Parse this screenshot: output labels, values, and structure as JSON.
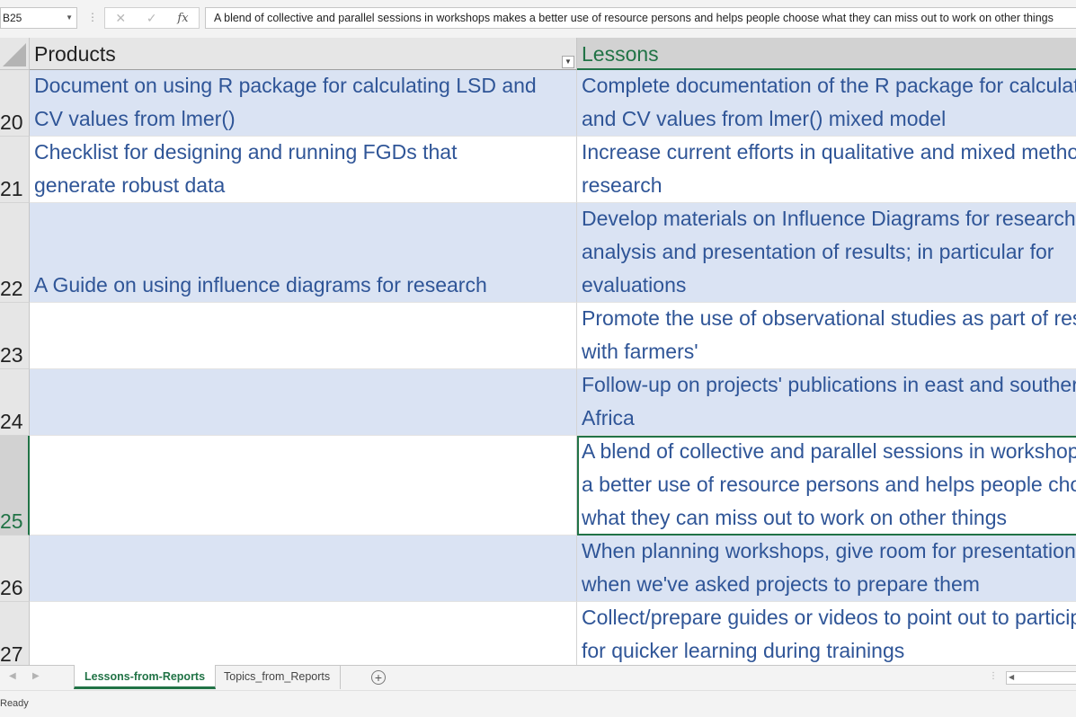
{
  "formula_bar": {
    "name_box": "B25",
    "cancel_icon": "✕",
    "enter_icon": "✓",
    "fx_label": "fx",
    "formula": "A blend of collective and parallel sessions in workshops makes a better use of resource persons and helps people choose what they can miss out to work on other things"
  },
  "columns": {
    "a": "Products",
    "b": "Lessons"
  },
  "rows": [
    {
      "num": "20",
      "a": "Document on using R package for calculating LSD and\nCV values from lmer()",
      "b": "Complete documentation of the R package for calculating LSD\nand CV values from lmer() mixed model"
    },
    {
      "num": "21",
      "a": "Checklist for designing and running FGDs that\ngenerate robust data",
      "b": "Increase current efforts in qualitative and mixed methods\nresearch"
    },
    {
      "num": "22",
      "a": "A Guide on using influence diagrams for research",
      "b": "Develop materials on Influence Diagrams for research design,\nanalysis and presentation of results; in particular for\nevaluations"
    },
    {
      "num": "23",
      "a": "",
      "b": "Promote the use of observational studies as part of research\nwith farmers'"
    },
    {
      "num": "24",
      "a": "",
      "b": "Follow-up on projects' publications in east and southern\nAfrica"
    },
    {
      "num": "25",
      "a": "",
      "b": "A blend of collective and parallel sessions in workshops makes\na better use of resource persons and helps people choose\nwhat they can miss out to work on other things"
    },
    {
      "num": "26",
      "a": "",
      "b": "When planning workshops, give room for presentations\nwhen we've asked projects to prepare them"
    },
    {
      "num": "27",
      "a": "",
      "b": "Collect/prepare guides or videos to point out to participants\nfor quicker learning during trainings"
    }
  ],
  "sheets": {
    "active": "Lessons-from-Reports",
    "other": "Topics_from_Reports",
    "add": "+"
  },
  "status": "Ready",
  "colors": {
    "accent": "#217346",
    "cell_text": "#2f5597",
    "band": "#dae3f3"
  }
}
